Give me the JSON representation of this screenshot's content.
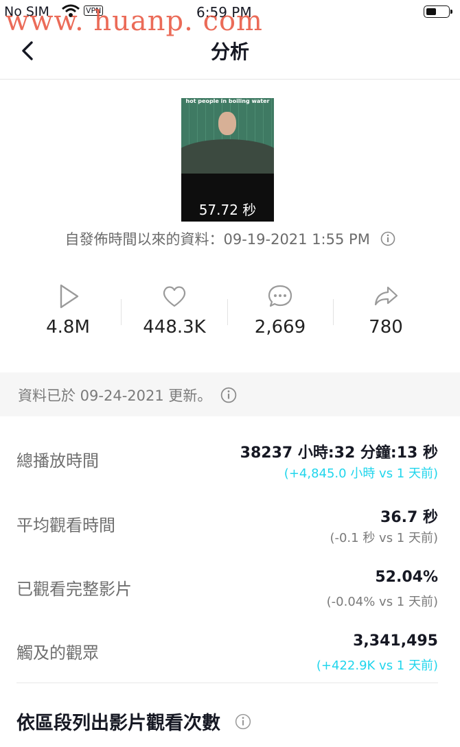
{
  "status_bar": {
    "carrier": "No SIM",
    "vpn": "VPN",
    "time": "6:59 PM"
  },
  "watermark": "www. huanp. com",
  "header": {
    "title": "分析"
  },
  "video": {
    "caption": "hot people in boiling water",
    "duration": "57.72 秒",
    "published_text": "自發佈時間以來的資料：09-19-2021 1:55 PM"
  },
  "stats": [
    {
      "icon": "play-icon",
      "value": "4.8M"
    },
    {
      "icon": "heart-icon",
      "value": "448.3K"
    },
    {
      "icon": "comment-icon",
      "value": "2,669"
    },
    {
      "icon": "share-icon",
      "value": "780"
    }
  ],
  "updated_text": "資料已於 09-24-2021 更新。",
  "metrics": [
    {
      "label": "總播放時間",
      "value": "38237 小時:32 分鐘:13 秒",
      "delta": "(+4,845.0 小時 vs 1 天前)",
      "delta_positive": true
    },
    {
      "label": "平均觀看時間",
      "value": "36.7 秒",
      "delta": "(-0.1 秒 vs 1 天前)",
      "delta_positive": false
    },
    {
      "label": "已觀看完整影片",
      "value": "52.04%",
      "delta": "(-0.04% vs 1 天前)",
      "delta_positive": false
    },
    {
      "label": "觸及的觀眾",
      "value": "3,341,495",
      "delta": "(+422.9K vs 1 天前)",
      "delta_positive": true
    }
  ],
  "section_title": "依區段列出影片觀看次數",
  "colors": {
    "positive": "#20d5ec",
    "watermark": "#e8523c"
  }
}
